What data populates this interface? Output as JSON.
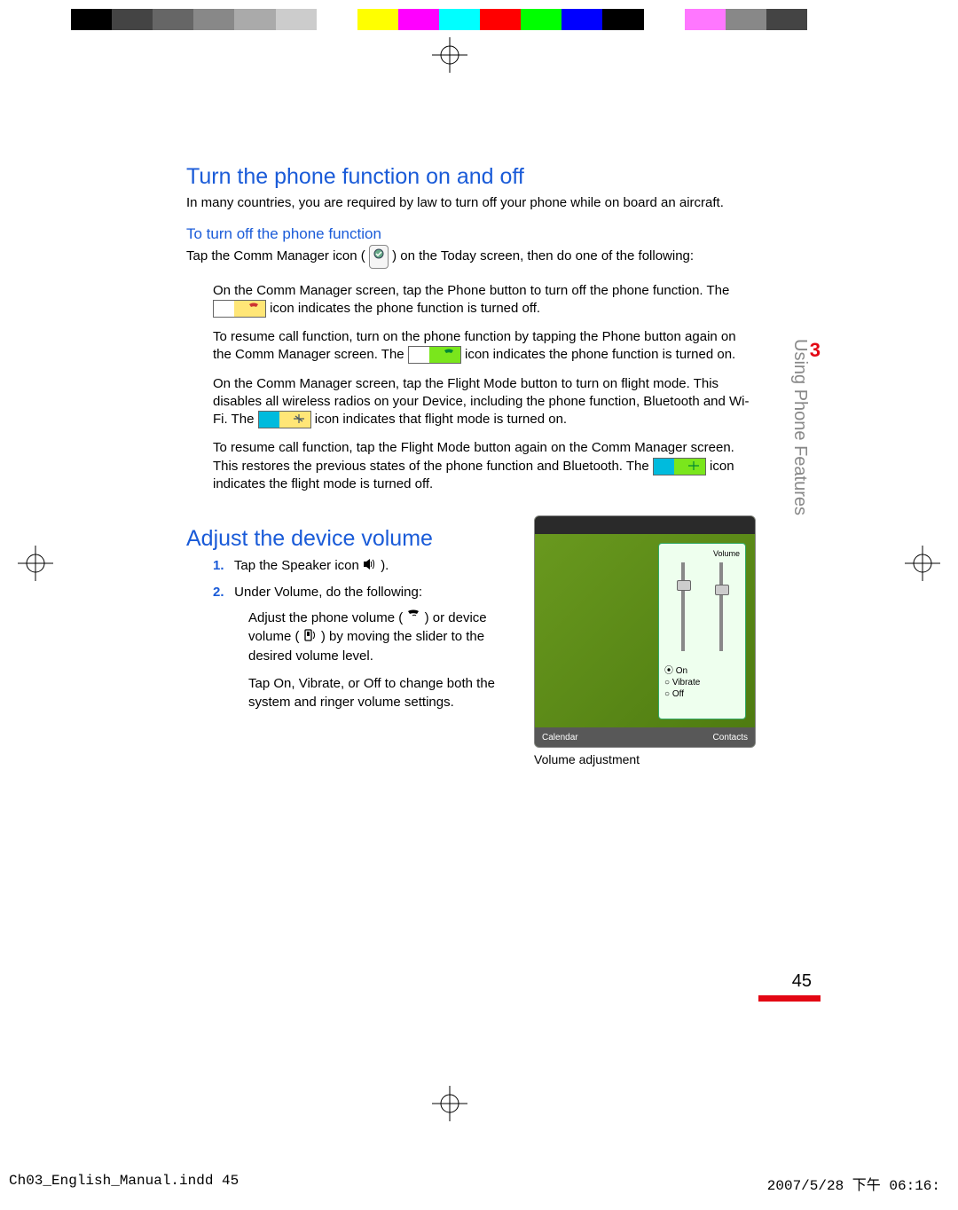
{
  "colorbar": [
    "#000",
    "#444",
    "#666",
    "#888",
    "#aaa",
    "#ccc",
    "#fff",
    "#ff0",
    "#f0f",
    "#0ff",
    "#f00",
    "#0f0",
    "#00f",
    "#000",
    "#fff",
    "#f7f",
    "#888",
    "#444"
  ],
  "chapter": {
    "num": "3",
    "title": "Using Phone Features"
  },
  "section1": {
    "heading": "Turn the phone function on and off",
    "intro": "In many countries, you are required by law to turn off your phone while on board an aircraft.",
    "sub": "To turn off the phone function",
    "lead_a": "Tap the ",
    "lead_b": "Comm Manager",
    "lead_c": " icon ( ",
    "lead_d": " ) on the Today screen, then do one of the following:",
    "b1_a": "On the Comm Manager screen, tap the ",
    "b1_b": "Phone",
    "b1_c": " button to turn off the phone function. The ",
    "b1_d": " icon indicates the phone function is turned off.",
    "b2_a": "To resume call function, turn on the phone function by tapping the ",
    "b2_b": "Phone",
    "b2_c": " button again on the Comm Manager screen. The ",
    "b2_d": " icon indicates the phone function is turned on.",
    "b3_a": "On the Comm Manager screen, tap the ",
    "b3_b": "Flight Mode",
    "b3_c": " button to turn on flight mode. This disables all wireless radios on your Device, including the phone function, Bluetooth and Wi-Fi. The ",
    "b3_d": " icon indicates that flight mode is turned on.",
    "b4_a": "To resume call function, tap the ",
    "b4_b": "Flight Mode",
    "b4_c": " button again on the Comm Manager screen. This restores the previous states of the phone function and Bluetooth. The ",
    "b4_d": " icon indicates the flight mode is turned off."
  },
  "section2": {
    "heading": "Adjust the device volume",
    "s1_num": "1.",
    "s1_a": "Tap the ",
    "s1_b": "Speaker",
    "s1_c": " icon ",
    "s1_d": " ).",
    "s2_num": "2.",
    "s2_a": "Under ",
    "s2_b": "Volume",
    "s2_c": ", do the following:",
    "sub1_a": "Adjust the phone volume ( ",
    "sub1_b": " ) or device volume ( ",
    "sub1_c": " ) by moving the slider to the desired volume level.",
    "sub2_a": "Tap ",
    "sub2_b": "On",
    "sub2_c": ", ",
    "sub2_d": "Vibrate",
    "sub2_e": ", or ",
    "sub2_f": "Off",
    "sub2_g": " to change both the system and ringer volume settings."
  },
  "screenshot": {
    "caption": "Volume adjustment",
    "popup_title": "Volume",
    "r_on": "On",
    "r_vib": "Vibrate",
    "r_off": "Off",
    "sb_l": "Calendar",
    "sb_r": "Contacts"
  },
  "page": "45",
  "footer": {
    "file": "Ch03_English_Manual.indd   45",
    "date": "2007/5/28   下午 06:16:"
  }
}
